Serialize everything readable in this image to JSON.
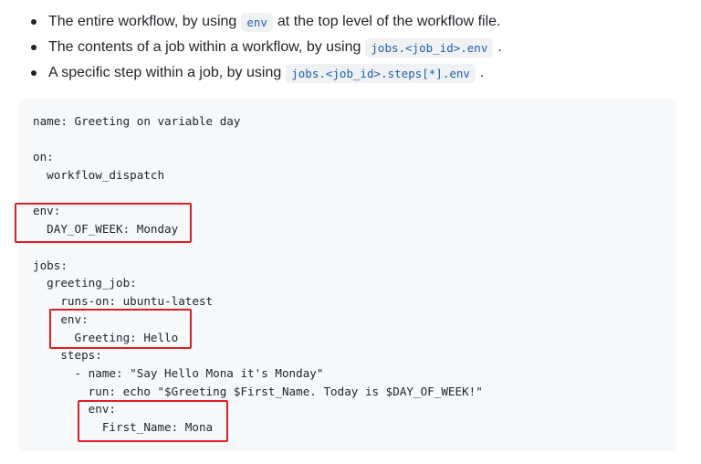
{
  "bullets": [
    {
      "before": "The entire workflow, by using",
      "code": "env",
      "after": "at the top level of the workflow file."
    },
    {
      "before": "The contents of a job within a workflow, by using",
      "code": "jobs.<job_id>.env",
      "after": "."
    },
    {
      "before": "A specific step within a job, by using",
      "code": "jobs.<job_id>.steps[*].env",
      "after": "."
    }
  ],
  "code_lines": [
    "name: Greeting on variable day",
    "",
    "on:",
    "  workflow_dispatch",
    "",
    "env:",
    "  DAY_OF_WEEK: Monday",
    "",
    "jobs:",
    "  greeting_job:",
    "    runs-on: ubuntu-latest",
    "    env:",
    "      Greeting: Hello",
    "    steps:",
    "      - name: \"Say Hello Mona it's Monday\"",
    "        run: echo \"$Greeting $First_Name. Today is $DAY_OF_WEEK!\"",
    "        env:",
    "          First_Name: Mona"
  ],
  "colors": {
    "highlight_border": "#e11d21",
    "code_background": "#f6f8fa",
    "inline_code_text": "#1f5fb0"
  }
}
